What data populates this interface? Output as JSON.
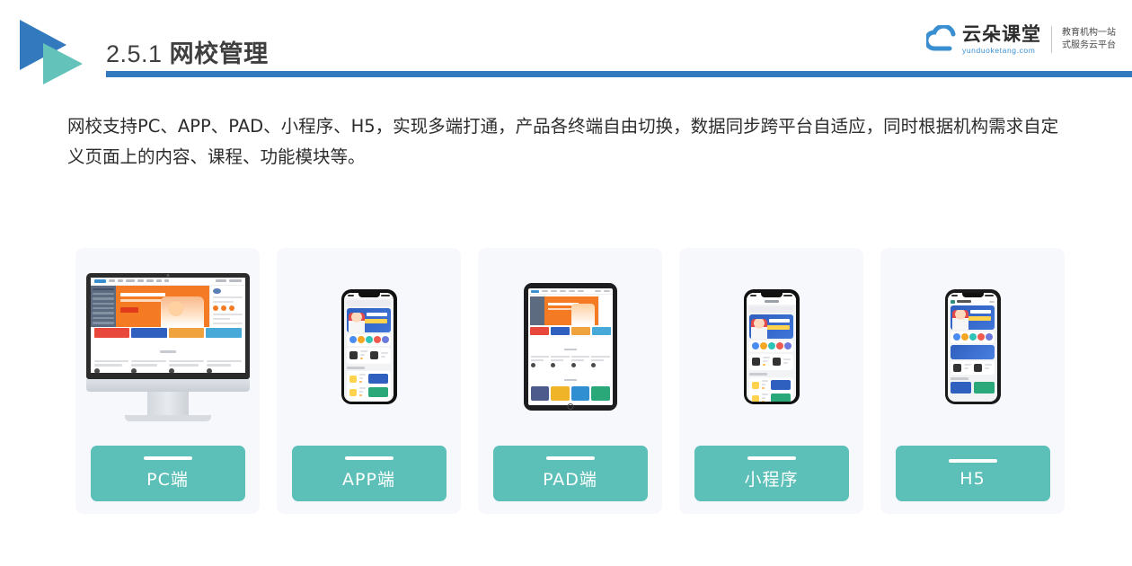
{
  "header": {
    "section_number": "2.5.1",
    "section_title": "网校管理",
    "logo_icon": "double-triangle-play-icon",
    "rule_color": "#3279be"
  },
  "brand": {
    "icon": "cloud-icon",
    "name_cn": "云朵课堂",
    "name_en": "yunduoketang.com",
    "tagline_line1": "教育机构一站",
    "tagline_line2": "式服务云平台"
  },
  "body": {
    "paragraph": "网校支持PC、APP、PAD、小程序、H5，实现多端打通，产品各终端自由切换，数据同步跨平台自适应，同时根据机构需求自定义页面上的内容、课程、功能模块等。"
  },
  "cards": [
    {
      "label": "PC端",
      "device": "desktop-monitor",
      "device_icon": "imac-icon"
    },
    {
      "label": "APP端",
      "device": "phone",
      "device_icon": "smartphone-icon"
    },
    {
      "label": "PAD端",
      "device": "tablet",
      "device_icon": "tablet-icon"
    },
    {
      "label": "小程序",
      "device": "phone",
      "device_icon": "smartphone-icon"
    },
    {
      "label": "H5",
      "device": "phone",
      "device_icon": "smartphone-icon"
    }
  ],
  "colors": {
    "accent_teal": "#5cc0b8",
    "accent_blue": "#3279be",
    "card_bg": "#f6f8fb",
    "text_dark": "#2d2d2d"
  }
}
